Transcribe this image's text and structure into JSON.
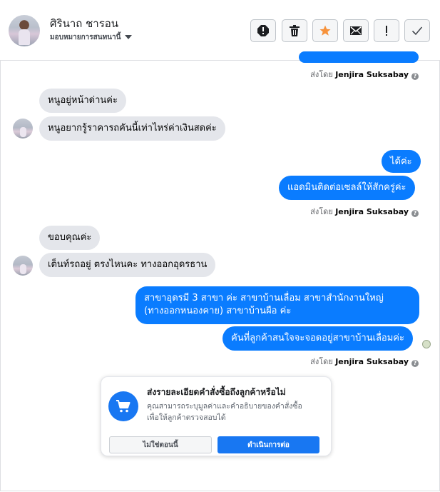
{
  "header": {
    "name": "ศิรินาถ ชารอน",
    "assign_label": "มอบหมายการสนทนานี้"
  },
  "toolbar": [
    {
      "name": "spam-icon"
    },
    {
      "name": "trash-icon"
    },
    {
      "name": "star-icon"
    },
    {
      "name": "mail-icon"
    },
    {
      "name": "exclamation-icon"
    },
    {
      "name": "checkmark-icon"
    }
  ],
  "messages": {
    "sent_by_prefix": "ส่งโดย",
    "agent": "Jenjira Suksabay",
    "help": "?",
    "m1": "หนูอยู่หน้าด่านค่ะ",
    "m2": "หนูอยากรู้ราคารถคันนี้เท่าไหร่ค่าเงินสดค่ะ",
    "m3": "ได้ค่ะ",
    "m4": "แอดมินติดต่อเซลล์ให้สักครู่ค่ะ",
    "m5": "ขอบคุณค่ะ",
    "m6": "เต็นท์รถอยู่ ตรงไหนคะ ทางออกอุดรธาน",
    "m7_line1": "สาขาอุดรมี 3 สาขา ค่ะ สาขาบ้านเลื่อม สาขาสำนักงานใหญ่",
    "m7_line2": "(ทางออกหนองคาย) สาขาบ้านผือ ค่ะ",
    "m8": "คันที่ลูกค้าสนใจจะจอดอยู่สาขาบ้านเลื่อมค่ะ"
  },
  "order_card": {
    "title": "ส่งรายละเอียดคำสั่งซื้อถึงลูกค้าหรือไม่",
    "desc_line1": "คุณสามารถระบุมูลค่าและคำอธิบายของคำสั่งซื้อ",
    "desc_line2": "เพื่อให้ลูกค้าตรวจสอบได้",
    "no_label": "ไม่ใช่ตอนนี้",
    "yes_label": "ดำเนินการต่อ"
  },
  "colors": {
    "outgoing_bubble": "#0a7cff",
    "incoming_bubble": "#e4e6eb",
    "primary_button": "#1877f2",
    "star": "#f7923b"
  }
}
